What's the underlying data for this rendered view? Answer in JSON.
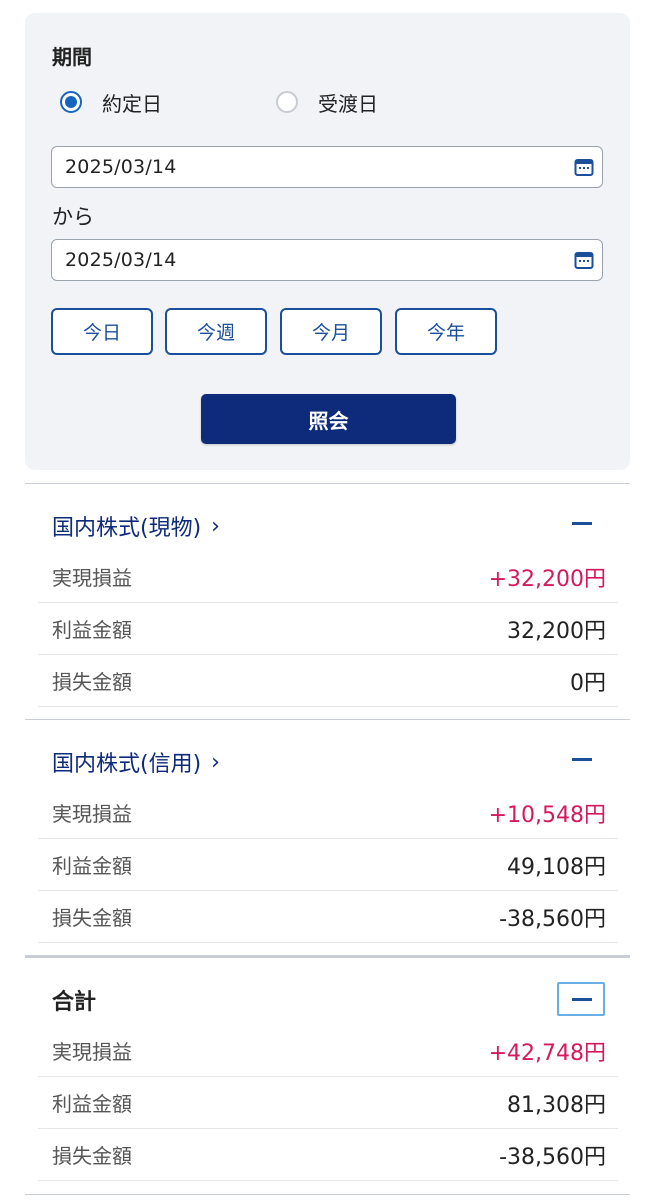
{
  "filter": {
    "period_label": "期間",
    "radios": [
      {
        "label": "約定日",
        "checked": true
      },
      {
        "label": "受渡日",
        "checked": false
      }
    ],
    "date_from": "2025/03/14",
    "separator": "から",
    "date_to": "2025/03/14",
    "quick_buttons": [
      "今日",
      "今週",
      "今月",
      "今年"
    ],
    "submit_label": "照会"
  },
  "sections": [
    {
      "title": "国内株式(現物)",
      "chevron": "›",
      "rows": [
        {
          "label": "実現損益",
          "value": "+32,200円",
          "positive": true
        },
        {
          "label": "利益金額",
          "value": "32,200円",
          "positive": false
        },
        {
          "label": "損失金額",
          "value": "0円",
          "positive": false
        }
      ]
    },
    {
      "title": "国内株式(信用)",
      "chevron": "›",
      "rows": [
        {
          "label": "実現損益",
          "value": "+10,548円",
          "positive": true
        },
        {
          "label": "利益金額",
          "value": "49,108円",
          "positive": false
        },
        {
          "label": "損失金額",
          "value": "-38,560円",
          "positive": false
        }
      ]
    },
    {
      "title": "合計",
      "rows": [
        {
          "label": "実現損益",
          "value": "+42,748円",
          "positive": true
        },
        {
          "label": "利益金額",
          "value": "81,308円",
          "positive": false
        },
        {
          "label": "損失金額",
          "value": "-38,560円",
          "positive": false
        }
      ]
    }
  ],
  "colors": {
    "accent": "#0e2a7a",
    "positive": "#d6185e",
    "panel_bg": "#f1f3f6"
  }
}
